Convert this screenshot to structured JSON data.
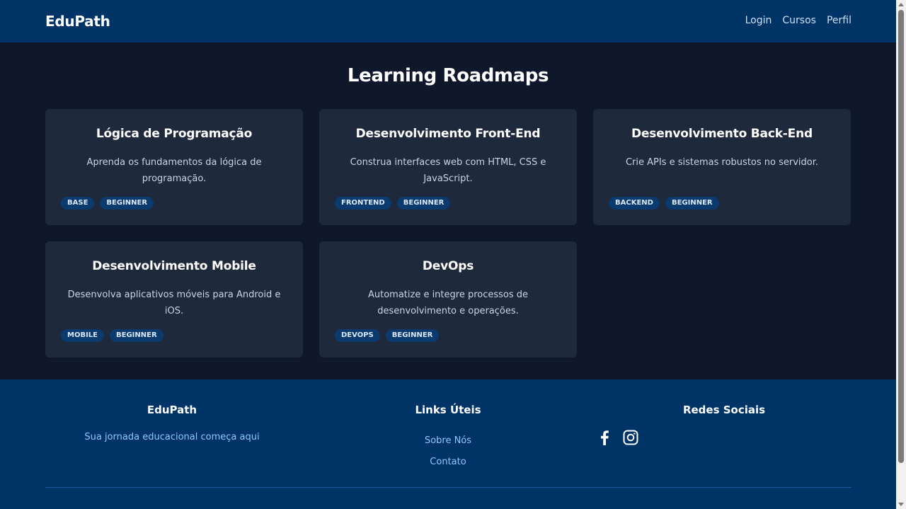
{
  "header": {
    "brand": "EduPath",
    "nav": [
      "Login",
      "Cursos",
      "Perfil"
    ]
  },
  "main": {
    "title": "Learning Roadmaps",
    "cards": [
      {
        "title": "Lógica de Programação",
        "description": "Aprenda os fundamentos da lógica de programação.",
        "tags": [
          "BASE",
          "BEGINNER"
        ]
      },
      {
        "title": "Desenvolvimento Front-End",
        "description": "Construa interfaces web com HTML, CSS e JavaScript.",
        "tags": [
          "FRONTEND",
          "BEGINNER"
        ]
      },
      {
        "title": "Desenvolvimento Back-End",
        "description": "Crie APIs e sistemas robustos no servidor.",
        "tags": [
          "BACKEND",
          "BEGINNER"
        ]
      },
      {
        "title": "Desenvolvimento Mobile",
        "description": "Desenvolva aplicativos móveis para Android e iOS.",
        "tags": [
          "MOBILE",
          "BEGINNER"
        ]
      },
      {
        "title": "DevOps",
        "description": "Automatize e integre processos de desenvolvimento e operações.",
        "tags": [
          "DEVOPS",
          "BEGINNER"
        ]
      }
    ]
  },
  "footer": {
    "about": {
      "heading": "EduPath",
      "text": "Sua jornada educacional começa aqui"
    },
    "links": {
      "heading": "Links Úteis",
      "items": [
        "Sobre Nós",
        "Contato"
      ]
    },
    "social": {
      "heading": "Redes Sociais",
      "icons": [
        "facebook-icon",
        "instagram-icon"
      ]
    }
  },
  "colors": {
    "header_bg": "#003366",
    "page_bg": "#0f172a",
    "card_bg": "#1e293b",
    "tag_bg": "#0b3a6e",
    "footer_link": "#93c5fd"
  }
}
